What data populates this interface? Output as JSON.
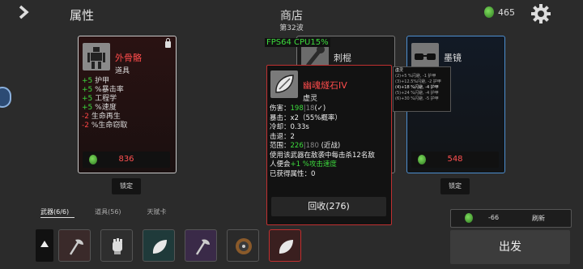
{
  "header": {
    "back_icon": "chevron-right-icon",
    "attr_title": "属性",
    "shop_title": "商店",
    "wave": "第32波",
    "money": "465",
    "settings_icon": "gear-icon"
  },
  "fps": "FPS64  CPU15%",
  "cards": [
    {
      "name": "外骨骼",
      "category": "道具",
      "price": "836",
      "lock_label": "锁定",
      "stats": [
        {
          "sign": "+5",
          "text": "护甲",
          "tone": "g"
        },
        {
          "sign": "+5",
          "text": "%暴击率",
          "tone": "g"
        },
        {
          "sign": "+5",
          "text": "工程学",
          "tone": "g"
        },
        {
          "sign": "+5",
          "text": "%速度",
          "tone": "g"
        },
        {
          "sign": "-2",
          "text": "生命再生",
          "tone": "r"
        },
        {
          "sign": "-2",
          "text": "%生命窃取",
          "tone": "r"
        }
      ]
    },
    {
      "name": "刺棍",
      "category": "",
      "price": "",
      "lock_label": ""
    },
    {
      "name": "墨镜",
      "category": "具",
      "price": "548",
      "lock_label": "锁定"
    }
  ],
  "tooltip": {
    "name": "幽魂燧石IV",
    "category": "虚灵",
    "damage_label": "伤害：",
    "damage_a": "198",
    "damage_b": "18",
    "damage_c": "(✓)",
    "crit": "暴击：x2（55%概率）",
    "cooldown": "冷却：0.33s",
    "knockback": "击退：2",
    "range_label": "范围：",
    "range_a": "226",
    "range_b": "180",
    "range_c": "(近战)",
    "desc_1": "使用该武器在敌袭中每击杀12名敌",
    "desc_2a": "人便会",
    "desc_2b": "+1 %攻击速度",
    "obtained": "已获得属性：0",
    "recycle": "回收(276)"
  },
  "mini_tooltip": {
    "title": "虚灵",
    "lines": [
      "(2)+5 %闪避, -1 护甲",
      "(3)+12.5%闪避, -2 护甲",
      "(4)+18 %闪避, -4 护甲",
      "(5)+24 %闪避, -4 护甲",
      "(6)+30 %闪避, -5 护甲"
    ]
  },
  "tabs": [
    "武器(6/6)",
    "道具(56)",
    "天赋卡"
  ],
  "slots": [
    {
      "icon": "axe-icon",
      "bg": "#3a2a2a"
    },
    {
      "icon": "gauntlet-icon",
      "bg": "#2e2e2e"
    },
    {
      "icon": "flint-icon",
      "bg": "#1f3a3a"
    },
    {
      "icon": "axe-icon",
      "bg": "#3a2a48"
    },
    {
      "icon": "chainsaw-icon",
      "bg": "#2a2a2a"
    },
    {
      "icon": "flint-icon",
      "bg": "#3a1f1f"
    }
  ],
  "refresh": {
    "cost": "-66",
    "label": "刷新"
  },
  "go_label": "出发",
  "colors": {
    "accent_red": "#ff4c4c",
    "positive": "#3ddc3d",
    "coin": "#4caf37",
    "card_blue": "#4d8fd0"
  }
}
